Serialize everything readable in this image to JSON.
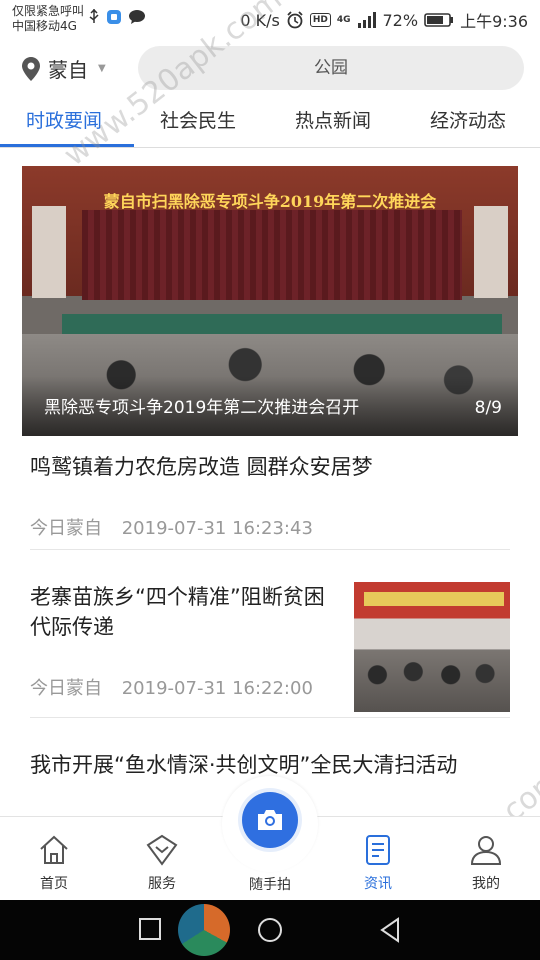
{
  "statusbar": {
    "carrier_line1": "仅限紧急呼叫",
    "carrier_line2": "中国移动4G",
    "speed": "0 K/s",
    "hd": "HD",
    "network": "4G",
    "battery": "72%",
    "time": "上午9:36"
  },
  "location": {
    "city": "蒙自"
  },
  "search": {
    "placeholder": "公园"
  },
  "tabs": [
    {
      "label": "时政要闻",
      "active": true
    },
    {
      "label": "社会民生",
      "active": false
    },
    {
      "label": "热点新闻",
      "active": false
    },
    {
      "label": "经济动态",
      "active": false
    }
  ],
  "carousel": {
    "image_banner_text": "蒙自市扫黑除恶专项斗争2019年第二次推进会",
    "caption": "黑除恶专项斗争2019年第二次推进会召开",
    "counter": "8/9"
  },
  "news": [
    {
      "title": "鸣鹫镇着力农危房改造 圆群众安居梦",
      "source": "今日蒙自",
      "datetime": "2019-07-31 16:23:43",
      "has_thumb": false
    },
    {
      "title": "老寨苗族乡“四个精准”阻断贫困代际传递",
      "source": "今日蒙自",
      "datetime": "2019-07-31 16:22:00",
      "has_thumb": true
    },
    {
      "title": "我市开展“鱼水情深·共创文明”全民大清扫活动",
      "has_thumb": false
    }
  ],
  "bottom_nav": [
    {
      "label": "首页",
      "icon": "home-icon",
      "active": false
    },
    {
      "label": "服务",
      "icon": "service-icon",
      "active": false
    },
    {
      "label": "随手拍",
      "icon": "camera-icon",
      "active": false
    },
    {
      "label": "资讯",
      "icon": "news-icon",
      "active": true
    },
    {
      "label": "我的",
      "icon": "user-icon",
      "active": false
    }
  ],
  "watermark": "www.520apk.com",
  "colors": {
    "accent": "#2a6fdb",
    "fab": "#2f6fe0"
  }
}
